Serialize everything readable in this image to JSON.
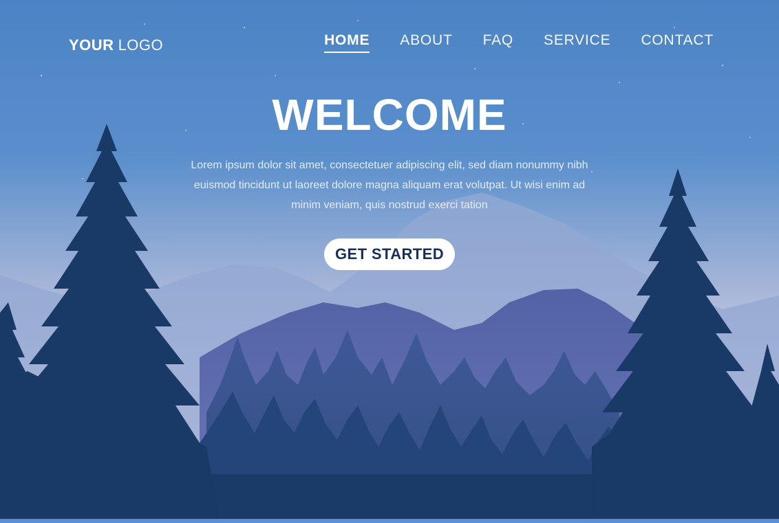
{
  "navbar": {
    "logo_primary": "YOUR",
    "logo_secondary": "LOGO",
    "items": [
      {
        "label": "HOME",
        "active": true
      },
      {
        "label": "ABOUT",
        "active": false
      },
      {
        "label": "FAQ",
        "active": false
      },
      {
        "label": "SERVICE",
        "active": false
      },
      {
        "label": "CONTACT",
        "active": false
      }
    ]
  },
  "hero": {
    "title": "WELCOME",
    "body": "Lorem ipsum dolor sit amet, consectetuer adipiscing elit, sed diam nonummy nibh euismod tincidunt ut laoreet dolore magna aliquam erat volutpat. Ut wisi enim ad minim veniam, quis nostrud exerci tation",
    "cta_label": "GET STARTED"
  },
  "colors": {
    "sky_top": "#4f86c6",
    "sky_bottom": "#c9d2e6",
    "forest": "#193a66",
    "cta_text": "#183056"
  }
}
